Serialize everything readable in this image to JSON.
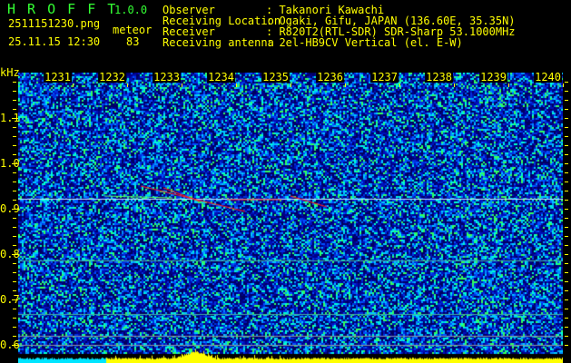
{
  "app": {
    "name": "H R O F F T",
    "version": "1.0.0"
  },
  "file": {
    "name": "2511151230.png",
    "datetime": "25.11.15 12:30"
  },
  "meteor": {
    "label": "meteor",
    "count": "83"
  },
  "info": [
    {
      "label": "Observer",
      "value": ": Takanori Kawachi"
    },
    {
      "label": "Receiving Location",
      "value": ": Ogaki, Gifu, JAPAN (136.60E, 35.35N)"
    },
    {
      "label": "Receiver",
      "value": ": R820T2(RTL-SDR) SDR-Sharp 53.1000MHz"
    },
    {
      "label": "Receiving antenna",
      "value": ": 2el-HB9CV Vertical (el. E-W)"
    }
  ],
  "axis": {
    "y_unit": "kHz",
    "y_ticks": [
      "1.1",
      "1.0",
      "0.9",
      "0.8",
      "0.7",
      "0.6"
    ],
    "x_ticks": [
      "1231",
      "1232",
      "1233",
      "1234",
      "1235",
      "1236",
      "1237",
      "1238",
      "1239",
      "1240"
    ]
  },
  "colors": {
    "text": "#ffff00",
    "title": "#33ff33",
    "background_noise": "#0a1aa0",
    "meteor_echo": "#ff2020",
    "spectrum_bar": "#ffff00",
    "spectrum_low": "#00e5ff"
  }
}
